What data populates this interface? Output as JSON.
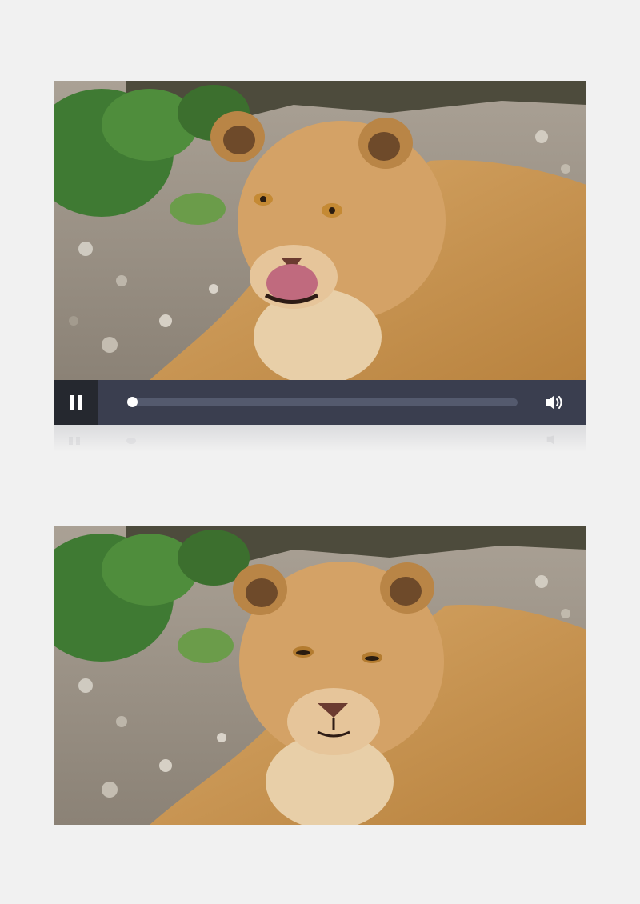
{
  "videos": [
    {
      "content": "lioness-licking-lips"
    },
    {
      "content": "lioness-resting"
    }
  ],
  "player": {
    "state": "playing",
    "progress": 0.0,
    "play_icon": "pause-icon",
    "volume_icon": "speaker-icon"
  },
  "colors": {
    "page_background": "#f1f1f1",
    "control_bar": "#3a3e4f",
    "play_button_box": "#25282f",
    "track": "#545a6e",
    "knob": "#ffffff"
  }
}
